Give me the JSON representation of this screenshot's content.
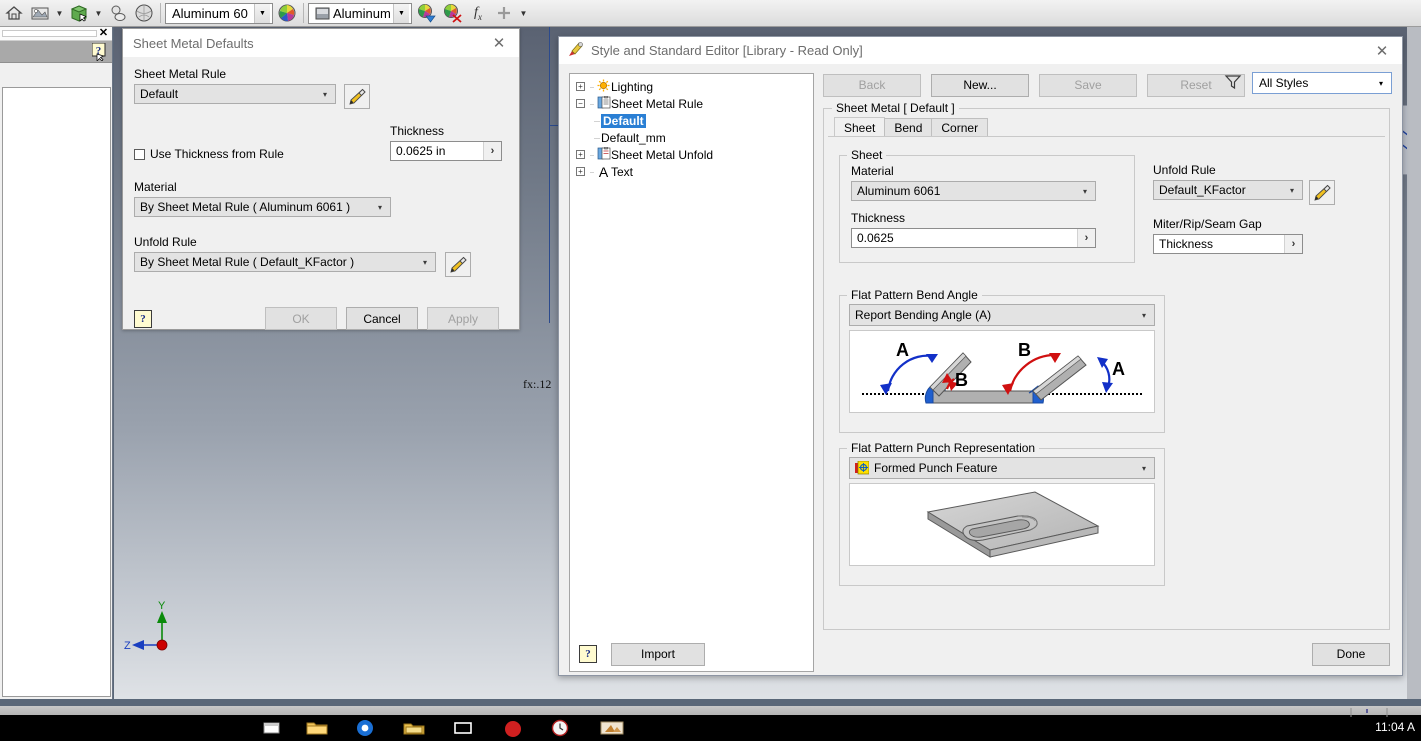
{
  "toolbar": {
    "icons": [
      "home-icon",
      "appearance-icon",
      "dropdown-caret",
      "material-box-icon",
      "dropdown-caret",
      "shaded-icon",
      "sphere-icon"
    ],
    "appearance_combo": {
      "value": "Aluminum 60",
      "name": "appearance-combo"
    },
    "material_combo": {
      "value": "Aluminum",
      "name": "material-combo"
    },
    "right_icons": [
      "adjust-appearance-icon",
      "clear-appearance-icon",
      "fx-icon",
      "plus-icon",
      "more-caret"
    ]
  },
  "viewport": {
    "fx_label": "fx:.12",
    "axis": {
      "y": "Y",
      "z": "Z"
    }
  },
  "sheet_metal_defaults": {
    "title": "Sheet Metal Defaults",
    "close_label": "✕",
    "rule_label": "Sheet Metal Rule",
    "rule_value": "Default",
    "edit_rule_icon": "pencil-icon",
    "use_thickness_label": "Use Thickness from Rule",
    "use_thickness_checked": false,
    "thickness_label": "Thickness",
    "thickness_value": "0.0625 in",
    "material_label": "Material",
    "material_value": "By Sheet Metal Rule ( Aluminum 6061 )",
    "unfold_label": "Unfold Rule",
    "unfold_value": "By Sheet Metal Rule ( Default_KFactor )",
    "edit_unfold_icon": "pencil-icon",
    "help_label": "?",
    "ok_label": "OK",
    "cancel_label": "Cancel",
    "apply_label": "Apply"
  },
  "style_editor": {
    "title": "Style and Standard Editor [Library - Read Only]",
    "title_icon": "style-editor-icon",
    "close_label": "✕",
    "tree": [
      {
        "label": "Lighting",
        "icon": "lighting-icon",
        "expander": "+",
        "level": 0,
        "selected": false
      },
      {
        "label": "Sheet Metal Rule",
        "icon": "rule-icon",
        "expander": "-",
        "level": 0,
        "selected": false
      },
      {
        "label": "Default",
        "icon": "",
        "expander": "",
        "level": 1,
        "selected": true
      },
      {
        "label": "Default_mm",
        "icon": "",
        "expander": "",
        "level": 1,
        "selected": false
      },
      {
        "label": "Sheet Metal Unfold",
        "icon": "unfold-icon",
        "expander": "+",
        "level": 0,
        "selected": false
      },
      {
        "label": "Text",
        "icon": "text-icon",
        "expander": "+",
        "level": 0,
        "selected": false
      }
    ],
    "buttons": {
      "back": "Back",
      "new": "New...",
      "save": "Save",
      "reset": "Reset"
    },
    "filter_icon": "filter-icon",
    "styles_filter_value": "All Styles",
    "panel_title": "Sheet Metal [ Default ]",
    "tabs": [
      {
        "label": "Sheet",
        "active": true
      },
      {
        "label": "Bend",
        "active": false
      },
      {
        "label": "Corner",
        "active": false
      }
    ],
    "sheet_group": {
      "title": "Sheet",
      "material_label": "Material",
      "material_value": "Aluminum 6061",
      "thickness_label": "Thickness",
      "thickness_value": "0.0625"
    },
    "unfold_rule": {
      "label": "Unfold Rule",
      "value": "Default_KFactor",
      "edit_icon": "pencil-icon"
    },
    "miter_gap": {
      "label": "Miter/Rip/Seam Gap",
      "value": "Thickness"
    },
    "bend_angle": {
      "title": "Flat Pattern Bend Angle",
      "value": "Report Bending Angle (A)",
      "diagram_labels": [
        "A",
        "B",
        "B",
        "A"
      ],
      "colors": {
        "angle_a": "#1230c8",
        "angle_b": "#d01010",
        "metal": "#a8a8a8",
        "bend": "#1f5fcf"
      }
    },
    "punch_rep": {
      "title": "Flat Pattern Punch Representation",
      "value": "Formed Punch Feature",
      "icon": "punch-feature-icon"
    },
    "footer": {
      "help_label": "?",
      "import_label": "Import",
      "done_label": "Done"
    }
  },
  "taskbar": {
    "clock": "11:04 A"
  }
}
